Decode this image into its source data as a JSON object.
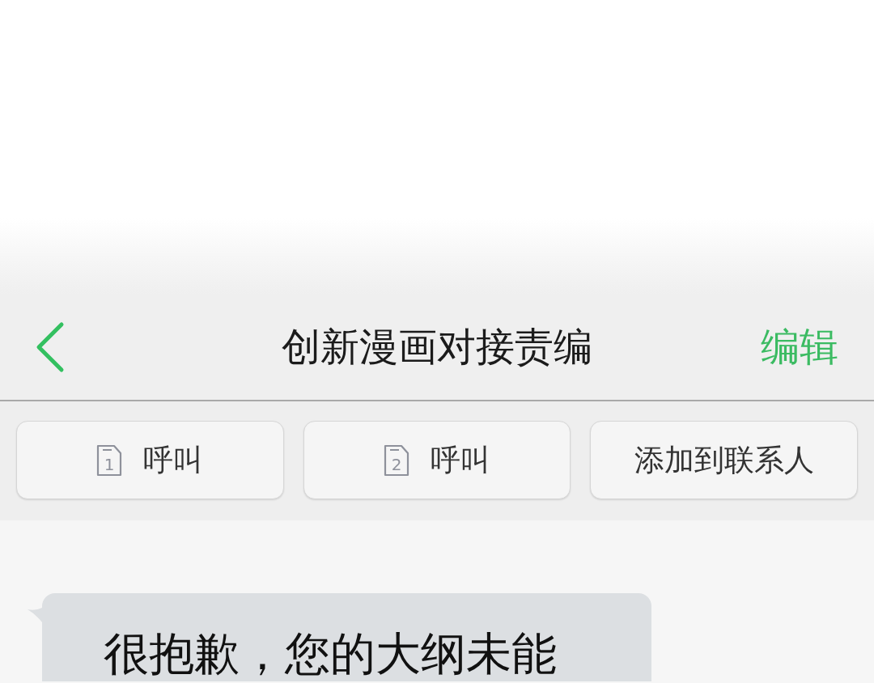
{
  "header": {
    "title": "创新漫画对接责编",
    "action": "编辑"
  },
  "actions": [
    {
      "kind": "call",
      "sim": "1",
      "label": "呼叫"
    },
    {
      "kind": "call",
      "sim": "2",
      "label": "呼叫"
    },
    {
      "kind": "plain",
      "label": "添加到联系人"
    }
  ],
  "messages": [
    {
      "kind": "incoming",
      "text": "很抱歉，您的大纲未能"
    }
  ]
}
